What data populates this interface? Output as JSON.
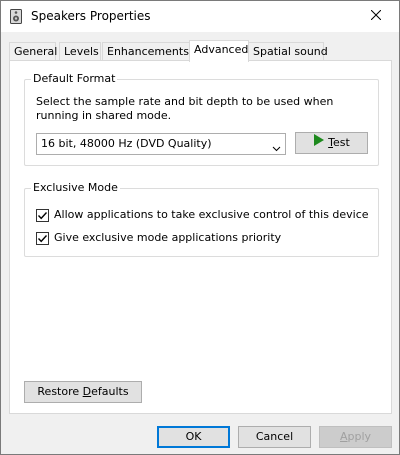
{
  "window": {
    "title": "Speakers Properties",
    "icon": "speaker-icon",
    "close_icon": "close-icon"
  },
  "tabs": [
    {
      "label": "General"
    },
    {
      "label": "Levels"
    },
    {
      "label": "Enhancements"
    },
    {
      "label": "Advanced",
      "selected": true
    },
    {
      "label": "Spatial sound"
    }
  ],
  "default_format": {
    "legend": "Default Format",
    "description": "Select the sample rate and bit depth to be used when running in shared mode.",
    "format_selected": "16 bit, 48000 Hz (DVD Quality)",
    "test_label_pre": "",
    "test_label_ul": "T",
    "test_label_post": "est",
    "play_icon": "play-icon"
  },
  "exclusive_mode": {
    "legend": "Exclusive Mode",
    "options": [
      {
        "label": "Allow applications to take exclusive control of this device",
        "checked": true
      },
      {
        "label": "Give exclusive mode applications priority",
        "checked": true
      }
    ]
  },
  "restore": {
    "label_pre": "Restore ",
    "label_ul": "D",
    "label_post": "efaults"
  },
  "footer": {
    "ok_label": "OK",
    "cancel_label": "Cancel",
    "apply_label_ul": "A",
    "apply_label_post": "pply",
    "apply_enabled": false
  },
  "colors": {
    "accent": "#0078d7",
    "play_green": "#1e8a1e"
  }
}
